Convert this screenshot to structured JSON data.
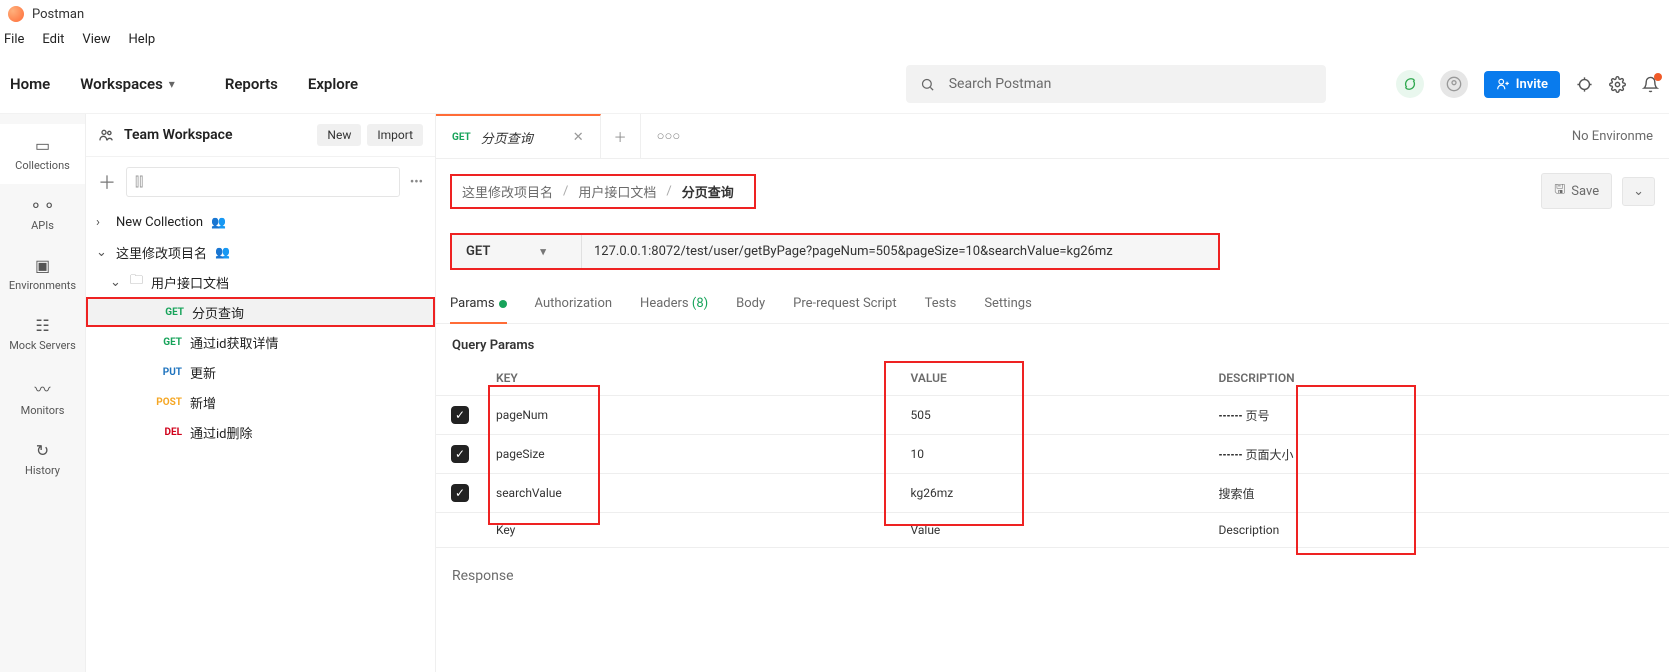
{
  "app": {
    "name": "Postman"
  },
  "menubar": {
    "file": "File",
    "edit": "Edit",
    "view": "View",
    "help": "Help"
  },
  "topnav": {
    "home": "Home",
    "workspaces": "Workspaces",
    "reports": "Reports",
    "explore": "Explore",
    "search_placeholder": "Search Postman",
    "invite": "Invite",
    "env_label": "No Environme"
  },
  "workspace": {
    "name": "Team Workspace",
    "new_btn": "New",
    "import_btn": "Import"
  },
  "vnav": {
    "collections": "Collections",
    "apis": "APIs",
    "environments": "Environments",
    "mock": "Mock Servers",
    "monitors": "Monitors",
    "history": "History"
  },
  "tree": {
    "new_collection": "New Collection",
    "project": "这里修改项目名",
    "folder": "用户接口文档",
    "items": [
      {
        "method": "GET",
        "cls": "m-get",
        "name": "分页查询"
      },
      {
        "method": "GET",
        "cls": "m-get",
        "name": "通过id获取详情"
      },
      {
        "method": "PUT",
        "cls": "m-put",
        "name": "更新"
      },
      {
        "method": "POST",
        "cls": "m-post",
        "name": "新增"
      },
      {
        "method": "DEL",
        "cls": "m-del",
        "name": "通过id删除"
      }
    ]
  },
  "tab": {
    "method": "GET",
    "name": "分页查询"
  },
  "breadcrumb": {
    "a": "这里修改项目名",
    "b": "用户接口文档",
    "c": "分页查询",
    "sep": "/"
  },
  "save_label": "Save",
  "request": {
    "method": "GET",
    "url": "127.0.0.1:8072/test/user/getByPage?pageNum=505&pageSize=10&searchValue=kg26mz"
  },
  "req_tabs": {
    "params": "Params",
    "auth": "Authorization",
    "headers": "Headers",
    "headers_count": "(8)",
    "body": "Body",
    "prescript": "Pre-request Script",
    "tests": "Tests",
    "settings": "Settings"
  },
  "qp": {
    "title": "Query Params",
    "cols": {
      "key": "KEY",
      "value": "VALUE",
      "desc": "DESCRIPTION"
    },
    "rows": [
      {
        "key": "pageNum",
        "value": "505",
        "desc": "页号"
      },
      {
        "key": "pageSize",
        "value": "10",
        "desc": "页面大小"
      },
      {
        "key": "searchValue",
        "value": "kg26mz",
        "desc": "搜索值"
      }
    ],
    "ph": {
      "key": "Key",
      "value": "Value",
      "desc": "Description"
    }
  },
  "response": "Response"
}
